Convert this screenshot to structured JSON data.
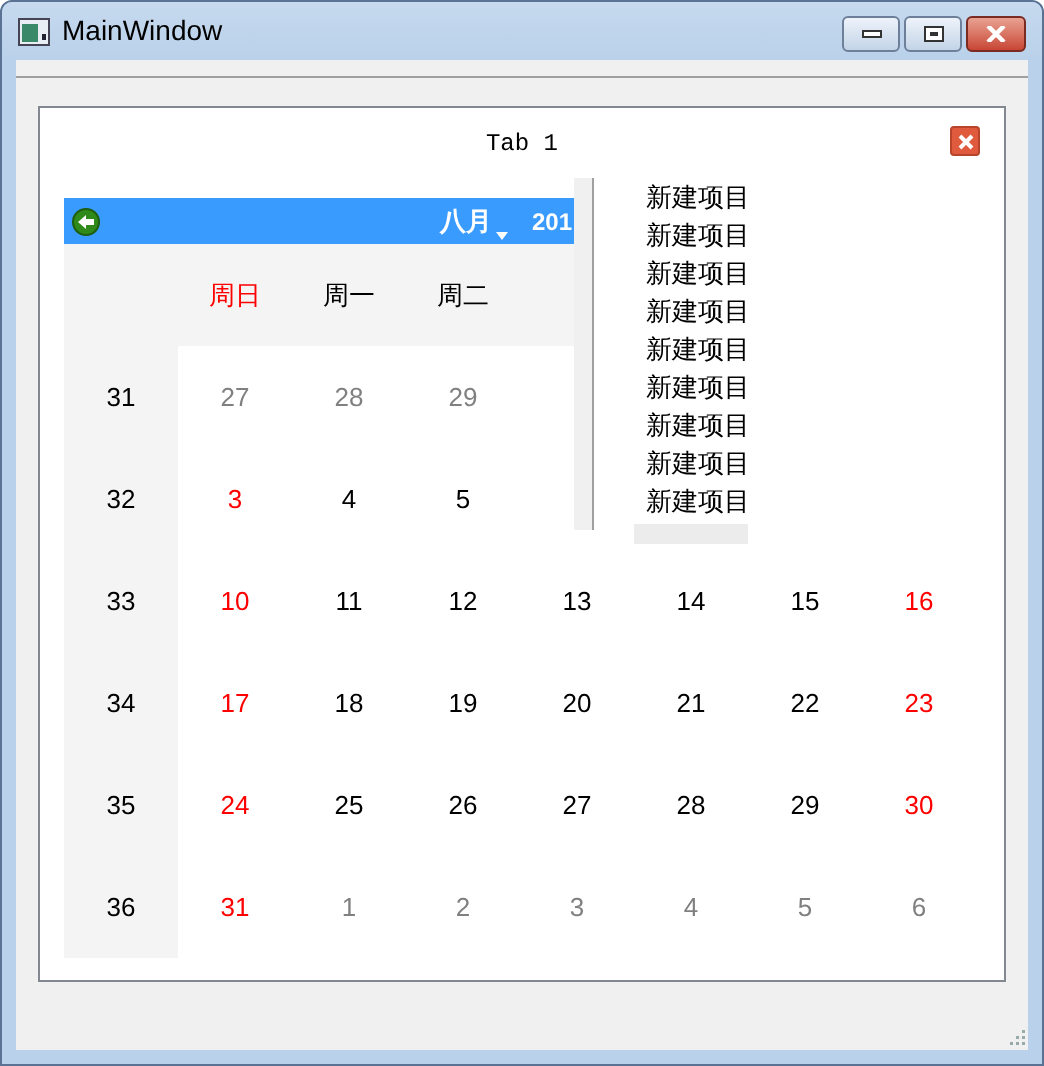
{
  "window": {
    "title": "MainWindow"
  },
  "tab": {
    "title": "Tab 1"
  },
  "calendar": {
    "month": "八月",
    "year": "201",
    "weekdays": [
      {
        "label": "周日",
        "weekend": true
      },
      {
        "label": "周一",
        "weekend": false
      },
      {
        "label": "周二",
        "weekend": false
      }
    ],
    "rows": [
      {
        "week": "31",
        "days": [
          {
            "label": "27",
            "kind": "muted"
          },
          {
            "label": "28",
            "kind": "muted"
          },
          {
            "label": "29",
            "kind": "muted"
          }
        ]
      },
      {
        "week": "32",
        "days": [
          {
            "label": "3",
            "kind": "weekend"
          },
          {
            "label": "4",
            "kind": "normal"
          },
          {
            "label": "5",
            "kind": "normal"
          }
        ]
      },
      {
        "week": "33",
        "days": [
          {
            "label": "10",
            "kind": "weekend"
          },
          {
            "label": "11",
            "kind": "normal"
          },
          {
            "label": "12",
            "kind": "normal"
          },
          {
            "label": "13",
            "kind": "normal"
          },
          {
            "label": "14",
            "kind": "normal"
          },
          {
            "label": "15",
            "kind": "normal"
          },
          {
            "label": "16",
            "kind": "weekend"
          }
        ]
      },
      {
        "week": "34",
        "days": [
          {
            "label": "17",
            "kind": "weekend"
          },
          {
            "label": "18",
            "kind": "normal"
          },
          {
            "label": "19",
            "kind": "normal"
          },
          {
            "label": "20",
            "kind": "normal"
          },
          {
            "label": "21",
            "kind": "normal"
          },
          {
            "label": "22",
            "kind": "normal"
          },
          {
            "label": "23",
            "kind": "weekend"
          }
        ]
      },
      {
        "week": "35",
        "days": [
          {
            "label": "24",
            "kind": "weekend"
          },
          {
            "label": "25",
            "kind": "normal"
          },
          {
            "label": "26",
            "kind": "normal"
          },
          {
            "label": "27",
            "kind": "normal"
          },
          {
            "label": "28",
            "kind": "normal"
          },
          {
            "label": "29",
            "kind": "normal"
          },
          {
            "label": "30",
            "kind": "weekend"
          }
        ]
      },
      {
        "week": "36",
        "days": [
          {
            "label": "31",
            "kind": "weekend"
          },
          {
            "label": "1",
            "kind": "muted"
          },
          {
            "label": "2",
            "kind": "muted"
          },
          {
            "label": "3",
            "kind": "muted"
          },
          {
            "label": "4",
            "kind": "muted"
          },
          {
            "label": "5",
            "kind": "muted"
          },
          {
            "label": "6",
            "kind": "muted"
          }
        ]
      }
    ]
  },
  "popup_list": {
    "items": [
      "新建项目",
      "新建项目",
      "新建项目",
      "新建项目",
      "新建项目",
      "新建项目",
      "新建项目",
      "新建项目",
      "新建项目"
    ]
  }
}
